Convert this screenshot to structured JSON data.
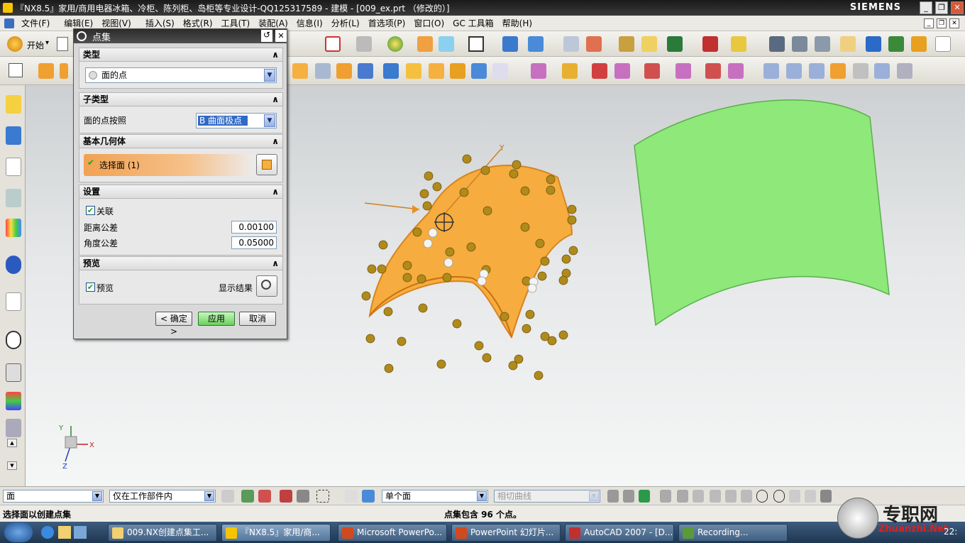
{
  "window": {
    "title": "『NX8.5』家用/商用电器冰箱、冷柜、陈列柜、岛柜等专业设计-QQ125317589 - 建模 - [009_ex.prt （修改的）]",
    "brand": "SIEMENS",
    "minimize": "_",
    "restore": "❐",
    "close": "✕"
  },
  "menubar": {
    "items": [
      "文件(F)",
      "编辑(E)",
      "视图(V)",
      "插入(S)",
      "格式(R)",
      "工具(T)",
      "装配(A)",
      "信息(I)",
      "分析(L)",
      "首选项(P)",
      "窗口(O)",
      "GC 工具箱",
      "帮助(H)"
    ],
    "start_label": "开始",
    "start_arrow": "▾"
  },
  "colors": {
    "accent_orange": "#f0a030",
    "green_surface": "#8ee87a",
    "point_gold": "#b08a1a",
    "dialog_bg": "#d9d9d9"
  },
  "dialog": {
    "title": "点集",
    "reset_icon": "↺",
    "close_icon": "✕",
    "sections": {
      "type": {
        "header": "类型",
        "value": "面的点"
      },
      "subtype": {
        "header": "子类型",
        "label": "面的点按照",
        "value": "B 曲面极点"
      },
      "base_geometry": {
        "header": "基本几何体",
        "select_label": "选择面 (1)"
      },
      "settings": {
        "header": "设置",
        "associative_label": "关联",
        "distance_tol_label": "距离公差",
        "distance_tol_value": "0.00100",
        "angle_tol_label": "角度公差",
        "angle_tol_value": "0.05000"
      },
      "preview": {
        "header": "预览",
        "preview_label": "预览",
        "show_result_label": "显示结果"
      }
    },
    "buttons": {
      "ok": "< 确定 >",
      "apply": "应用",
      "cancel": "取消"
    }
  },
  "viewport": {
    "triad_x": "X",
    "triad_y": "Y",
    "triad_z": "Z",
    "csys_y": "Y"
  },
  "bottom": {
    "filter_type": "面",
    "scope": "仅在工作部件内",
    "face_rule": "单个面",
    "curve_rule": "相切曲线"
  },
  "status": {
    "prompt": "选择面以创建点集",
    "message": "点集包含 96 个点。"
  },
  "taskbar": {
    "tasks": [
      "009.NX创建点集工...",
      "『NX8.5』家用/商...",
      "Microsoft PowerPo...",
      "PowerPoint 幻灯片...",
      "AutoCAD 2007 - [D...",
      "Recording..."
    ],
    "clock": "22:",
    "watermark": "专职网",
    "watermark_url": "Zhuanzhi.Net"
  }
}
